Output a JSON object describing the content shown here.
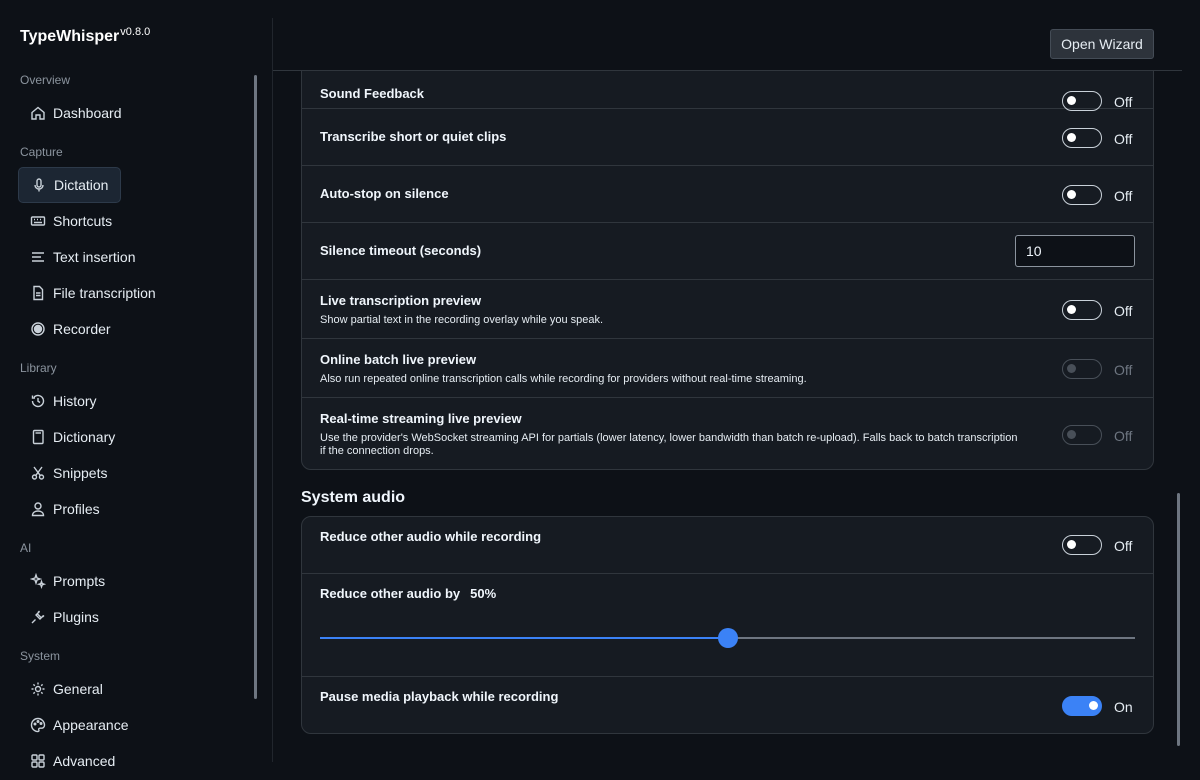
{
  "app": {
    "name": "TypeWhisper",
    "version": "v0.8.0"
  },
  "header": {
    "open_wizard": "Open Wizard"
  },
  "sidebar": {
    "sections": [
      {
        "label": "Overview",
        "items": [
          {
            "label": "Dashboard",
            "icon": "home-icon"
          }
        ]
      },
      {
        "label": "Capture",
        "items": [
          {
            "label": "Dictation",
            "icon": "microphone-icon",
            "active": true
          },
          {
            "label": "Shortcuts",
            "icon": "keyboard-icon"
          },
          {
            "label": "Text insertion",
            "icon": "text-lines-icon"
          },
          {
            "label": "File transcription",
            "icon": "file-icon"
          },
          {
            "label": "Recorder",
            "icon": "record-icon"
          }
        ]
      },
      {
        "label": "Library",
        "items": [
          {
            "label": "History",
            "icon": "history-icon"
          },
          {
            "label": "Dictionary",
            "icon": "book-icon"
          },
          {
            "label": "Snippets",
            "icon": "scissors-icon"
          },
          {
            "label": "Profiles",
            "icon": "person-icon"
          }
        ]
      },
      {
        "label": "AI",
        "items": [
          {
            "label": "Prompts",
            "icon": "sparkle-icon"
          },
          {
            "label": "Plugins",
            "icon": "plug-icon"
          }
        ]
      },
      {
        "label": "System",
        "items": [
          {
            "label": "General",
            "icon": "gear-icon"
          },
          {
            "label": "Appearance",
            "icon": "palette-icon"
          },
          {
            "label": "Advanced",
            "icon": "advanced-icon"
          }
        ]
      }
    ]
  },
  "dictation_card": {
    "rows": [
      {
        "title": "Sound Feedback",
        "toggle": "Off"
      },
      {
        "title": "Transcribe short or quiet clips",
        "toggle": "Off"
      },
      {
        "title": "Auto-stop on silence",
        "toggle": "Off"
      },
      {
        "title": "Silence timeout (seconds)",
        "value": "10"
      },
      {
        "title": "Live transcription preview",
        "desc": "Show partial text in the recording overlay while you speak.",
        "toggle": "Off"
      },
      {
        "title": "Online batch live preview",
        "desc": "Also run repeated online transcription calls while recording for providers without real-time streaming.",
        "toggle": "Off",
        "disabled": true
      },
      {
        "title": "Real-time streaming live preview",
        "desc": "Use the provider's WebSocket streaming API for partials (lower latency, lower bandwidth than batch re-upload). Falls back to batch transcription if the connection drops.",
        "toggle": "Off",
        "disabled": true
      }
    ]
  },
  "system_audio": {
    "heading": "System audio",
    "reduce": {
      "title": "Reduce other audio while recording",
      "toggle": "Off"
    },
    "reduce_by": {
      "title": "Reduce other audio by",
      "value_label": "50%",
      "value": 0.5
    },
    "pause": {
      "title": "Pause media playback while recording",
      "toggle": "On"
    }
  },
  "colors": {
    "accent": "#3b82f6",
    "background": "#0d1117",
    "card": "#161b22"
  }
}
